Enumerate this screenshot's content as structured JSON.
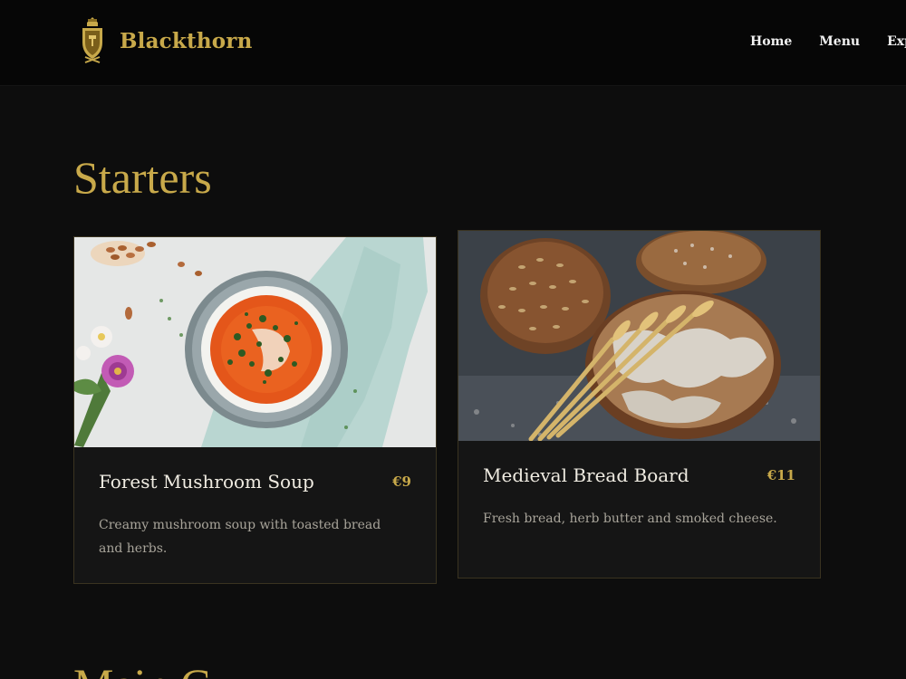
{
  "header": {
    "brand": "Blackthorn",
    "logo_icon": "crest-icon",
    "nav": [
      "Home",
      "Menu",
      "Exp"
    ]
  },
  "sections": [
    {
      "title": "Starters",
      "items": [
        {
          "name": "Forest Mushroom Soup",
          "price": "€9",
          "description": "Creamy mushroom soup with toasted bread and herbs.",
          "image": "soup-bowl-photo"
        },
        {
          "name": "Medieval Bread Board",
          "price": "€11",
          "description": "Fresh bread, herb butter and smoked cheese.",
          "image": "bread-loaves-photo"
        }
      ]
    },
    {
      "title": "Main C"
    }
  ],
  "colors": {
    "accent": "#c8a94a",
    "background": "#0d0d0d",
    "header": "#060606",
    "card": "#151515"
  }
}
